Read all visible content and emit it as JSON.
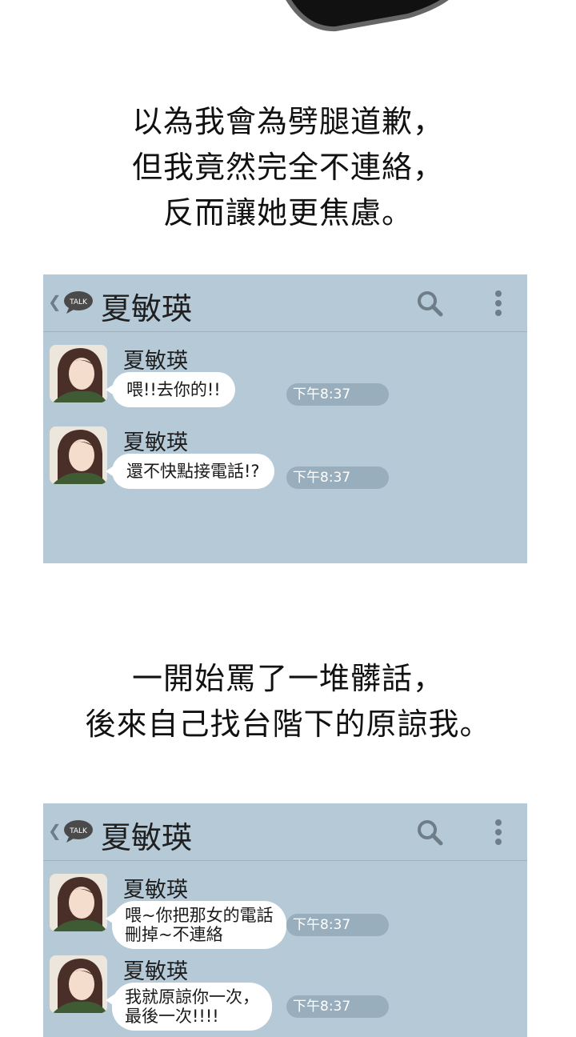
{
  "narration_top": {
    "lines": [
      "以為我會為劈腿道歉，",
      "但我竟然完全不連絡，",
      "反而讓她更焦慮。"
    ]
  },
  "narration_middle": {
    "lines": [
      "一開始罵了一堆髒話，",
      "後來自己找台階下的原諒我。"
    ]
  },
  "chat_1": {
    "header_title": "夏敏瑛",
    "messages": [
      {
        "sender": "夏敏瑛",
        "lines": [
          "喂!!去你的!!"
        ],
        "time": "下午8:37"
      },
      {
        "sender": "夏敏瑛",
        "lines": [
          "還不快點接電話!?"
        ],
        "time": "下午8:37"
      }
    ]
  },
  "chat_2": {
    "header_title": "夏敏瑛",
    "messages": [
      {
        "sender": "夏敏瑛",
        "lines": [
          "喂~你把那女的電話",
          "刪掉~不連絡"
        ],
        "time": "下午8:37"
      },
      {
        "sender": "夏敏瑛",
        "lines": [
          "我就原諒你一次，",
          "最後一次!!!!"
        ],
        "time": "下午8:37"
      }
    ]
  },
  "icons": {
    "back": "chevron-left-icon",
    "talk": "talk-bubble-icon",
    "search": "search-icon",
    "more": "more-vertical-icon"
  },
  "colors": {
    "chat_background": "#b5c9d7",
    "bubble": "#ffffff",
    "time_pill": "#98aebd"
  }
}
